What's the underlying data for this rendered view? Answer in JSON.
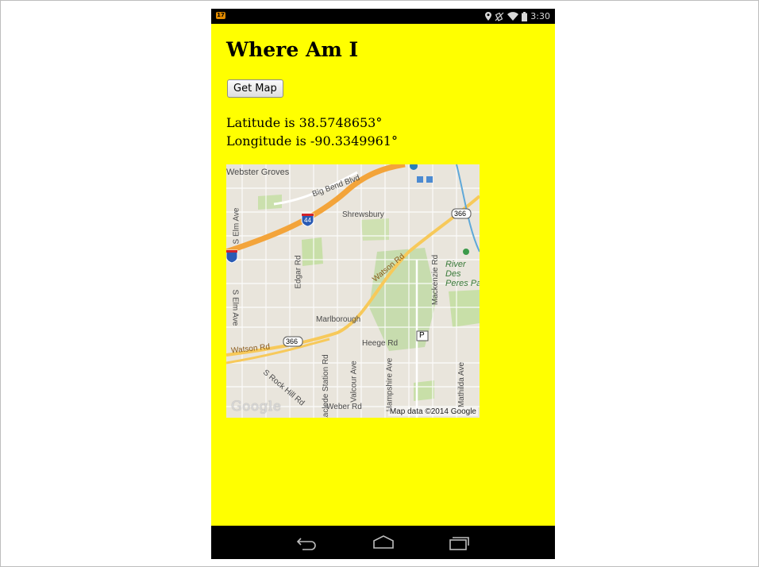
{
  "status_bar": {
    "notification_badge": "17",
    "time": "3:30",
    "icons": [
      "location-icon",
      "vibrate-icon",
      "wifi-icon",
      "battery-icon"
    ]
  },
  "app": {
    "title": "Where Am I",
    "get_map_label": "Get Map",
    "latitude_text": "Latitude is 38.5748653°",
    "longitude_text": "Longitude is -90.3349961°"
  },
  "map": {
    "labels": {
      "webster_groves": "Webster Groves",
      "big_bend": "Big Bend Blvd",
      "shrewsbury": "Shrewsbury",
      "s_elm_ave_top": "S Elm Ave",
      "s_elm_ave_bottom": "S Elm Ave",
      "edgar_rd": "Edgar Rd",
      "watson_rd_top": "Watson Rd",
      "watson_rd_left": "Watson Rd",
      "mackenzie_rd": "Mackenzie Rd",
      "river_des_peres": "River Des Peres Pa",
      "marlborough": "Marlborough",
      "heege_rd": "Heege Rd",
      "rock_hill_rd": "S Rock Hill Rd",
      "laclede_station": "Laclede Station Rd",
      "valcour_ave": "Valcour Ave",
      "hampshire_ave": "Hampshire Ave",
      "mathilda_ave": "Mathilda Ave",
      "weber_rd": "Weber Rd",
      "route_366_top": "366",
      "route_366_bottom": "366",
      "interstate_44": "44",
      "parking": "P"
    },
    "logo": "Google",
    "attribution": "Map data ©2014 Google"
  },
  "colors": {
    "app_background": "#ffff00",
    "status_bar": "#000000",
    "nav_bar": "#000000"
  },
  "nav": {
    "icons": [
      "back-icon",
      "home-icon",
      "recent-apps-icon"
    ]
  }
}
